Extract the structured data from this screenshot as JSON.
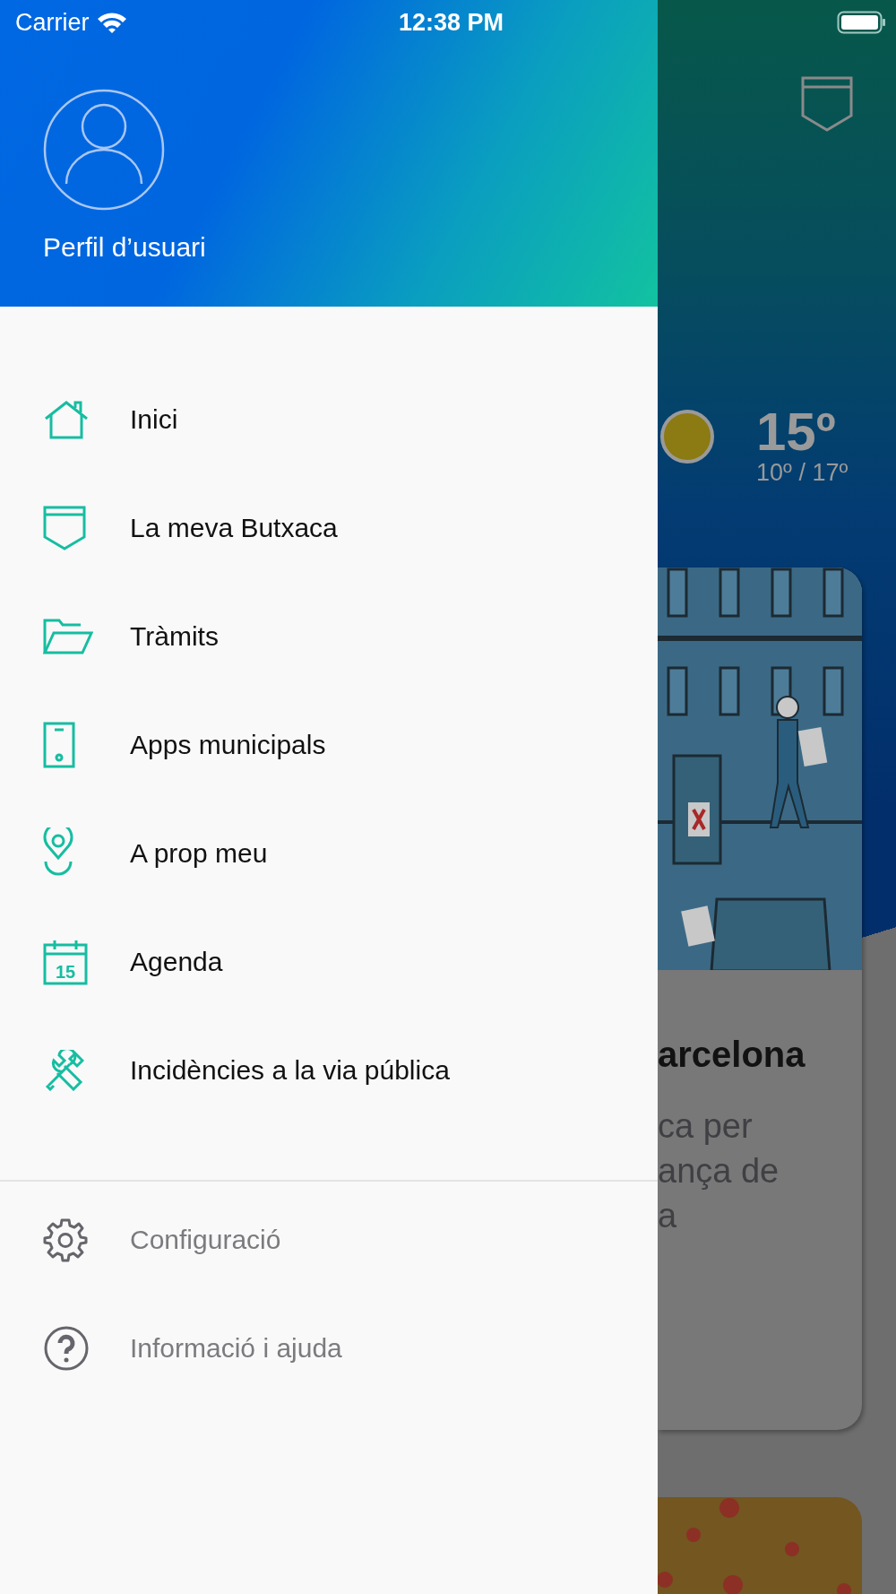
{
  "status_bar": {
    "carrier": "Carrier",
    "time": "12:38 PM"
  },
  "drawer": {
    "profile": {
      "label": "Perfil d’usuari"
    },
    "menu": [
      {
        "kind": "home",
        "label": "Inici"
      },
      {
        "kind": "pocket",
        "label": "La meva Butxaca"
      },
      {
        "kind": "folder",
        "label": "Tràmits"
      },
      {
        "kind": "phone",
        "label": "Apps municipals"
      },
      {
        "kind": "pin",
        "label": "A prop meu"
      },
      {
        "kind": "calendar",
        "label": "Agenda",
        "icon_text": "15"
      },
      {
        "kind": "tools",
        "label": "Incidències a la via pública"
      }
    ],
    "secondary": [
      {
        "kind": "gear",
        "label": "Configuració"
      },
      {
        "kind": "help",
        "label": "Informació i ajuda"
      }
    ]
  },
  "background": {
    "weather": {
      "temperature": "15º",
      "range": "10º / 17º"
    },
    "card": {
      "title": "arcelona",
      "body_lines": [
        "ca per",
        "ança de",
        "a"
      ]
    }
  }
}
